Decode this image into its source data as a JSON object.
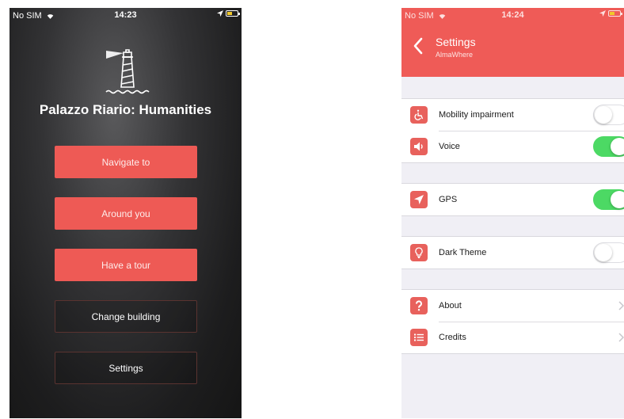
{
  "home_screen": {
    "status_bar": {
      "carrier": "No SIM",
      "time": "14:23"
    },
    "building_name": "Palazzo Riario: Humanities",
    "buttons": {
      "navigate": "Navigate to",
      "around": "Around you",
      "tour": "Have a tour",
      "change_building": "Change building",
      "settings": "Settings"
    }
  },
  "settings_screen": {
    "status_bar": {
      "carrier": "No SIM",
      "time": "14:24"
    },
    "header": {
      "title": "Settings",
      "subtitle": "AlmaWhere"
    },
    "items": {
      "mobility": {
        "label": "Mobility impairment",
        "icon": "wheelchair-icon",
        "enabled": false
      },
      "voice": {
        "label": "Voice",
        "icon": "speaker-icon",
        "enabled": true
      },
      "gps": {
        "label": "GPS",
        "icon": "location-arrow-icon",
        "enabled": true
      },
      "dark_theme": {
        "label": "Dark Theme",
        "icon": "lightbulb-icon",
        "enabled": false
      },
      "about": {
        "label": "About",
        "icon": "question-icon"
      },
      "credits": {
        "label": "Credits",
        "icon": "list-icon"
      }
    }
  },
  "colors": {
    "accent": "#ee5a55",
    "toggle_on": "#4cd964",
    "dark_background": "#1d1d1e",
    "settings_background": "#f0eff5"
  }
}
